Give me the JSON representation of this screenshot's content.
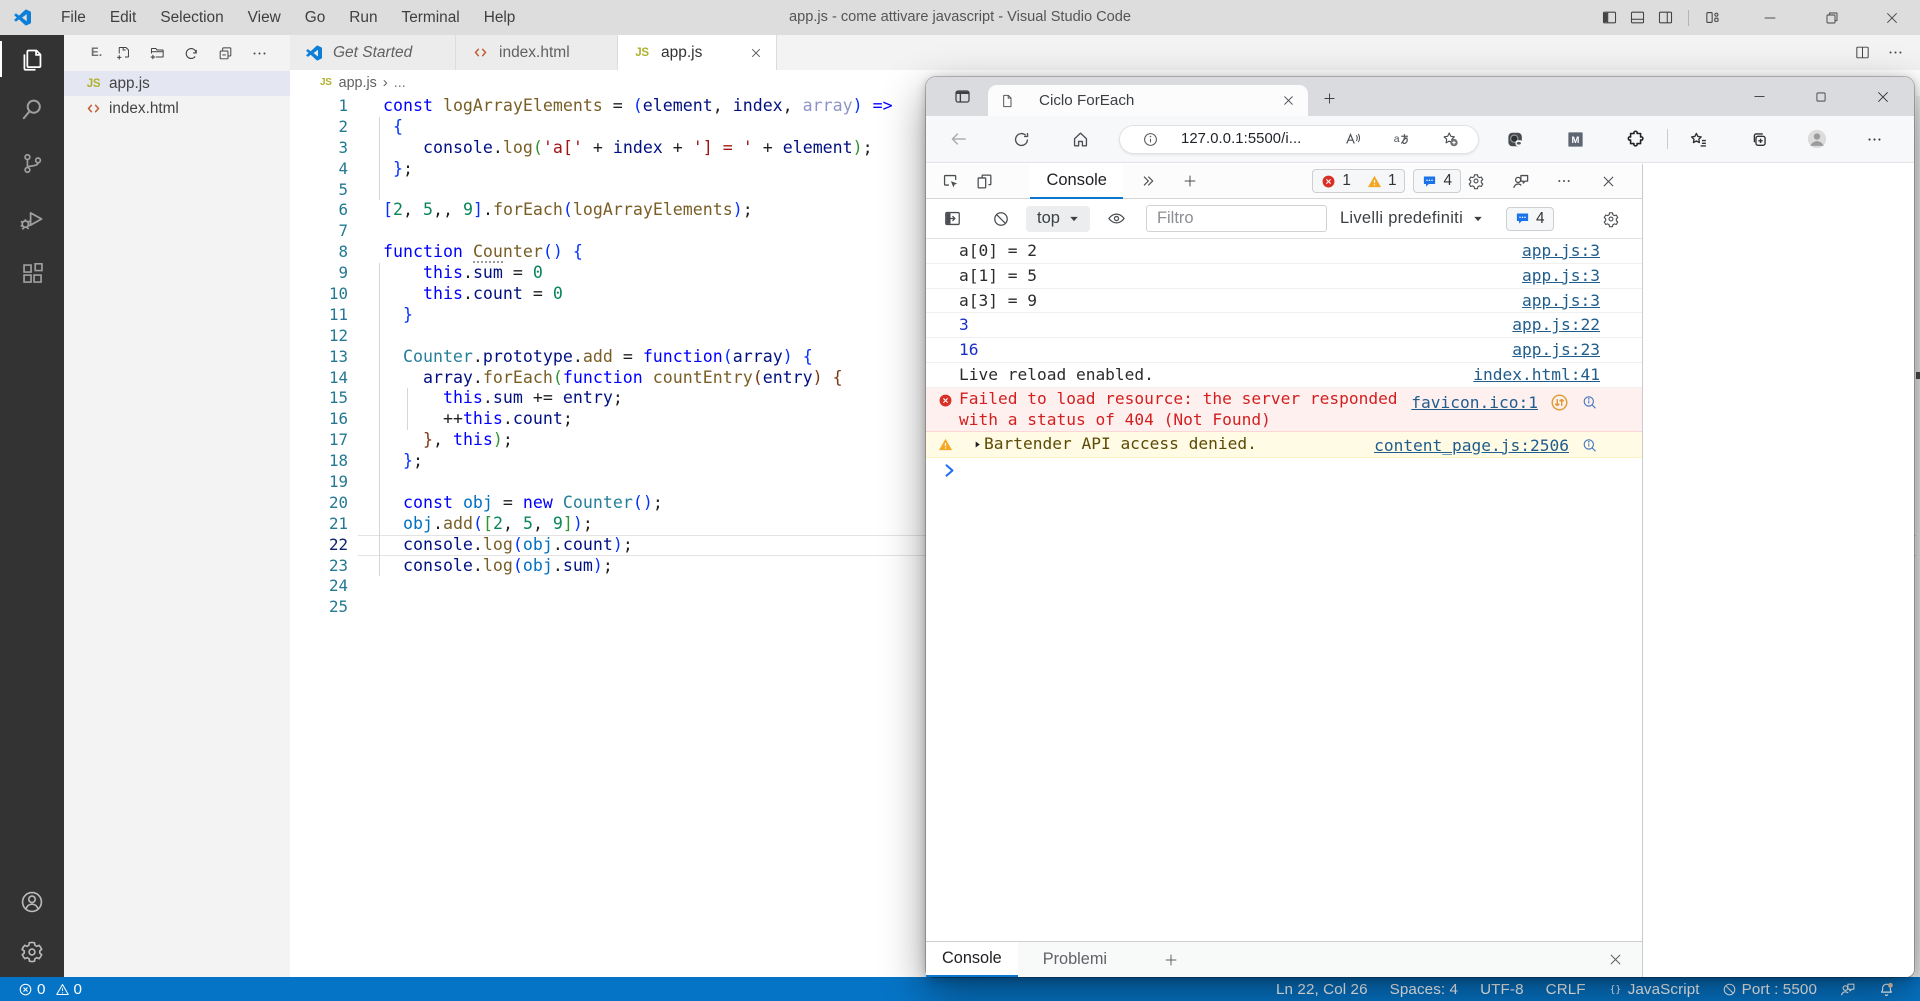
{
  "vscode": {
    "titlebar": {
      "menus": [
        "File",
        "Edit",
        "Selection",
        "View",
        "Go",
        "Run",
        "Terminal",
        "Help"
      ],
      "title": "app.js - come attivare javascript - Visual Studio Code"
    },
    "explorer": {
      "header": "E.",
      "files": [
        {
          "name": "app.js",
          "icon": "js",
          "selected": true
        },
        {
          "name": "index.html",
          "icon": "html",
          "selected": false
        }
      ]
    },
    "tabs": [
      {
        "label": "Get Started",
        "icon": "vscode",
        "italic": true,
        "active": false
      },
      {
        "label": "index.html",
        "icon": "html",
        "italic": false,
        "active": false
      },
      {
        "label": "app.js",
        "icon": "js",
        "italic": false,
        "active": true,
        "close": true
      }
    ],
    "breadcrumb": {
      "file": "app.js",
      "more": "..."
    },
    "editor": {
      "active_line": 22,
      "syntax_colors": {
        "keyword": "#0000FF",
        "function": "#795E26",
        "variable": "#001080",
        "const_variable": "#0070C1",
        "class": "#267F99",
        "string": "#A31515",
        "number": "#098658",
        "bracket1": "#0431FA",
        "bracket2": "#319331",
        "bracket3": "#7B3814"
      },
      "lines": [
        {
          "n": 1,
          "guides": [],
          "tokens": [
            [
              "const",
              "kw"
            ],
            [
              " ",
              "pun"
            ],
            [
              "logArrayElements",
              "fn"
            ],
            [
              " = ",
              "pun"
            ],
            [
              "(",
              "b1"
            ],
            [
              "element",
              "var"
            ],
            [
              ", ",
              "pun"
            ],
            [
              "index",
              "var"
            ],
            [
              ", ",
              "pun"
            ],
            [
              "array",
              "unused"
            ],
            [
              ")",
              "b1"
            ],
            [
              " ",
              "pun"
            ],
            [
              "=>",
              "kw"
            ]
          ]
        },
        {
          "n": 2,
          "guides": [
            0
          ],
          "tokens": [
            [
              " ",
              "pun"
            ],
            [
              "{",
              "b1"
            ]
          ]
        },
        {
          "n": 3,
          "guides": [
            0
          ],
          "tokens": [
            [
              "    ",
              "pun"
            ],
            [
              "console",
              "var"
            ],
            [
              ".",
              "pun"
            ],
            [
              "log",
              "fn"
            ],
            [
              "(",
              "b2"
            ],
            [
              "'a['",
              "str"
            ],
            [
              " + ",
              "pun"
            ],
            [
              "index",
              "var"
            ],
            [
              " + ",
              "pun"
            ],
            [
              "'] = '",
              "str"
            ],
            [
              " + ",
              "pun"
            ],
            [
              "element",
              "var"
            ],
            [
              ")",
              "b2"
            ],
            [
              ";",
              "pun"
            ]
          ]
        },
        {
          "n": 4,
          "guides": [
            0
          ],
          "tokens": [
            [
              " ",
              "pun"
            ],
            [
              "}",
              "b1"
            ],
            [
              ";",
              "pun"
            ]
          ]
        },
        {
          "n": 5,
          "guides": [
            0
          ],
          "tokens": []
        },
        {
          "n": 6,
          "guides": [],
          "tokens": [
            [
              "[",
              "b1"
            ],
            [
              "2",
              "num"
            ],
            [
              ", ",
              "pun"
            ],
            [
              "5",
              "num"
            ],
            [
              ",, ",
              "pun"
            ],
            [
              "9",
              "num"
            ],
            [
              "]",
              "b1"
            ],
            [
              ".",
              "pun"
            ],
            [
              "forEach",
              "fn"
            ],
            [
              "(",
              "b1"
            ],
            [
              "logArrayElements",
              "fn"
            ],
            [
              ")",
              "b1"
            ],
            [
              ";",
              "pun"
            ]
          ]
        },
        {
          "n": 7,
          "guides": [],
          "tokens": []
        },
        {
          "n": 8,
          "guides": [],
          "tokens": [
            [
              "function",
              "kw"
            ],
            [
              " ",
              "pun"
            ],
            [
              "Cou",
              "fnd"
            ],
            [
              "nter",
              "fn"
            ],
            [
              "(",
              "b1"
            ],
            [
              ")",
              "b1"
            ],
            [
              " ",
              "pun"
            ],
            [
              "{",
              "b1"
            ]
          ]
        },
        {
          "n": 9,
          "guides": [
            0
          ],
          "tokens": [
            [
              "    ",
              "pun"
            ],
            [
              "this",
              "kw"
            ],
            [
              ".",
              "pun"
            ],
            [
              "sum",
              "var"
            ],
            [
              " = ",
              "pun"
            ],
            [
              "0",
              "num"
            ]
          ]
        },
        {
          "n": 10,
          "guides": [
            0
          ],
          "tokens": [
            [
              "    ",
              "pun"
            ],
            [
              "this",
              "kw"
            ],
            [
              ".",
              "pun"
            ],
            [
              "count",
              "var"
            ],
            [
              " = ",
              "pun"
            ],
            [
              "0",
              "num"
            ]
          ]
        },
        {
          "n": 11,
          "guides": [
            0
          ],
          "tokens": [
            [
              "  ",
              "pun"
            ],
            [
              "}",
              "b1"
            ]
          ]
        },
        {
          "n": 12,
          "guides": [
            0
          ],
          "tokens": []
        },
        {
          "n": 13,
          "guides": [
            0
          ],
          "tokens": [
            [
              "  ",
              "pun"
            ],
            [
              "Counter",
              "cls"
            ],
            [
              ".",
              "pun"
            ],
            [
              "prototype",
              "var"
            ],
            [
              ".",
              "pun"
            ],
            [
              "add",
              "fn"
            ],
            [
              " = ",
              "pun"
            ],
            [
              "function",
              "kw"
            ],
            [
              "(",
              "b1"
            ],
            [
              "array",
              "var"
            ],
            [
              ")",
              "b1"
            ],
            [
              " ",
              "pun"
            ],
            [
              "{",
              "b1"
            ]
          ]
        },
        {
          "n": 14,
          "guides": [
            0
          ],
          "tokens": [
            [
              "    ",
              "pun"
            ],
            [
              "array",
              "var"
            ],
            [
              ".",
              "pun"
            ],
            [
              "forEach",
              "fn"
            ],
            [
              "(",
              "b2"
            ],
            [
              "function",
              "kw"
            ],
            [
              " ",
              "pun"
            ],
            [
              "countEntry",
              "fn"
            ],
            [
              "(",
              "b3"
            ],
            [
              "entry",
              "var"
            ],
            [
              ")",
              "b3"
            ],
            [
              " ",
              "pun"
            ],
            [
              "{",
              "b3"
            ]
          ]
        },
        {
          "n": 15,
          "guides": [
            0,
            1
          ],
          "tokens": [
            [
              "      ",
              "pun"
            ],
            [
              "this",
              "kw"
            ],
            [
              ".",
              "pun"
            ],
            [
              "sum",
              "var"
            ],
            [
              " += ",
              "pun"
            ],
            [
              "entry",
              "var"
            ],
            [
              ";",
              "pun"
            ]
          ]
        },
        {
          "n": 16,
          "guides": [
            0,
            1
          ],
          "tokens": [
            [
              "      ",
              "pun"
            ],
            [
              "++",
              "pun"
            ],
            [
              "this",
              "kw"
            ],
            [
              ".",
              "pun"
            ],
            [
              "count",
              "var"
            ],
            [
              ";",
              "pun"
            ]
          ]
        },
        {
          "n": 17,
          "guides": [
            0
          ],
          "tokens": [
            [
              "    ",
              "pun"
            ],
            [
              "}",
              "b3"
            ],
            [
              ", ",
              "pun"
            ],
            [
              "this",
              "kw"
            ],
            [
              ")",
              "b2"
            ],
            [
              ";",
              "pun"
            ]
          ]
        },
        {
          "n": 18,
          "guides": [
            0
          ],
          "tokens": [
            [
              "  ",
              "pun"
            ],
            [
              "}",
              "b1"
            ],
            [
              ";",
              "pun"
            ]
          ]
        },
        {
          "n": 19,
          "guides": [
            0
          ],
          "tokens": []
        },
        {
          "n": 20,
          "guides": [
            0
          ],
          "tokens": [
            [
              "  ",
              "pun"
            ],
            [
              "const",
              "kw"
            ],
            [
              " ",
              "pun"
            ],
            [
              "obj",
              "cvar"
            ],
            [
              " = ",
              "pun"
            ],
            [
              "new",
              "kw"
            ],
            [
              " ",
              "pun"
            ],
            [
              "Counter",
              "cls"
            ],
            [
              "(",
              "b1"
            ],
            [
              ")",
              "b1"
            ],
            [
              ";",
              "pun"
            ]
          ]
        },
        {
          "n": 21,
          "guides": [
            0
          ],
          "tokens": [
            [
              "  ",
              "pun"
            ],
            [
              "obj",
              "cvar"
            ],
            [
              ".",
              "pun"
            ],
            [
              "add",
              "fn"
            ],
            [
              "(",
              "b1"
            ],
            [
              "[",
              "b2"
            ],
            [
              "2",
              "num"
            ],
            [
              ", ",
              "pun"
            ],
            [
              "5",
              "num"
            ],
            [
              ", ",
              "pun"
            ],
            [
              "9",
              "num"
            ],
            [
              "]",
              "b2"
            ],
            [
              ")",
              "b1"
            ],
            [
              ";",
              "pun"
            ]
          ]
        },
        {
          "n": 22,
          "guides": [
            0
          ],
          "tokens": [
            [
              "  ",
              "pun"
            ],
            [
              "console",
              "var"
            ],
            [
              ".",
              "pun"
            ],
            [
              "log",
              "fn"
            ],
            [
              "(",
              "b1"
            ],
            [
              "obj",
              "cvar"
            ],
            [
              ".",
              "pun"
            ],
            [
              "count",
              "var"
            ],
            [
              ")",
              "b1"
            ],
            [
              ";",
              "pun"
            ]
          ]
        },
        {
          "n": 23,
          "guides": [
            0
          ],
          "tokens": [
            [
              "  ",
              "pun"
            ],
            [
              "console",
              "var"
            ],
            [
              ".",
              "pun"
            ],
            [
              "log",
              "fn"
            ],
            [
              "(",
              "b1"
            ],
            [
              "obj",
              "cvar"
            ],
            [
              ".",
              "pun"
            ],
            [
              "sum",
              "var"
            ],
            [
              ")",
              "b1"
            ],
            [
              ";",
              "pun"
            ]
          ]
        },
        {
          "n": 24,
          "guides": [],
          "tokens": []
        },
        {
          "n": 25,
          "guides": [],
          "tokens": []
        }
      ]
    },
    "statusbar": {
      "errors": "0",
      "warnings": "0",
      "items": [
        {
          "icon": "",
          "label": "Ln 22, Col 26"
        },
        {
          "icon": "",
          "label": "Spaces: 4"
        },
        {
          "icon": "",
          "label": "UTF-8"
        },
        {
          "icon": "",
          "label": "CRLF"
        },
        {
          "icon": "braces",
          "label": "JavaScript"
        },
        {
          "icon": "blocked",
          "label": "Port : 5500"
        }
      ]
    },
    "accent": "#0674C6"
  },
  "edge": {
    "tab_title": "Ciclo ForEach",
    "url": "127.0.0.1:5500/i...",
    "devtools": {
      "active_panel": "Console",
      "badges": {
        "errors": "1",
        "warnings": "1",
        "messages": "4"
      },
      "console_toolbar": {
        "context": "top",
        "filter_placeholder": "Filtro",
        "levels": "Livelli predefiniti",
        "messages": "4"
      },
      "rows": [
        {
          "type": "log",
          "text": "a[0] = 2",
          "loc": "app.js:3"
        },
        {
          "type": "log",
          "text": "a[1] = 5",
          "loc": "app.js:3"
        },
        {
          "type": "log",
          "text": "a[3] = 9",
          "loc": "app.js:3"
        },
        {
          "type": "num",
          "text": "3",
          "loc": "app.js:22"
        },
        {
          "type": "num",
          "text": "16",
          "loc": "app.js:23"
        },
        {
          "type": "log",
          "text": "Live reload enabled.",
          "loc": "index.html:41"
        },
        {
          "type": "error",
          "text": "Failed to load resource: the server responded \nwith a status of 404 (Not Found)",
          "loc": "favicon.ico:1"
        },
        {
          "type": "warn",
          "text": "Bartender API access denied.",
          "loc": "content_page.js:2506"
        },
        {
          "type": "prompt",
          "text": "",
          "loc": ""
        }
      ],
      "drawer_tabs": [
        {
          "label": "Console",
          "active": true
        },
        {
          "label": "Problemi",
          "active": false
        }
      ]
    }
  }
}
